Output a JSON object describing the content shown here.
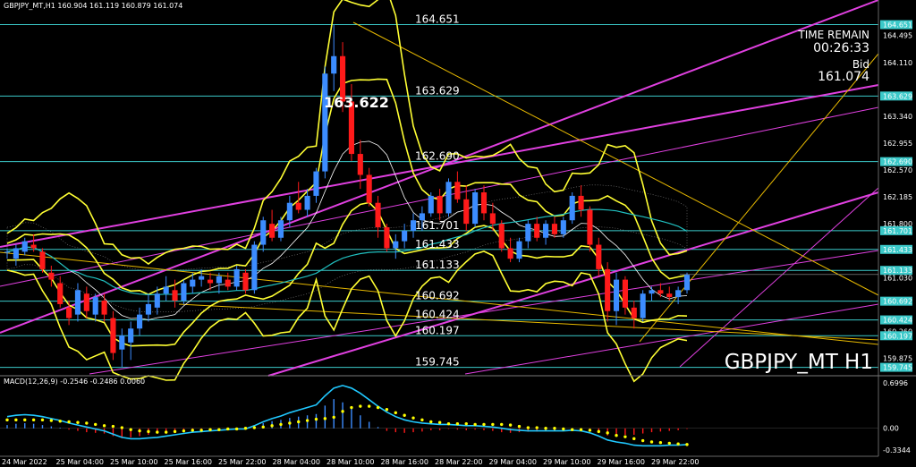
{
  "header": {
    "symbol_info": "GBPJPY_MT,H1  160.904 161.119 160.879 161.074"
  },
  "overlay": {
    "time_remain_label": "TIME REMAIN",
    "time_remain_value": "00:26:33",
    "bid_label": "Bid",
    "bid_value": "161.074",
    "watermark": "GBPJPY_MT H1",
    "peak_label": "163.622"
  },
  "macd": {
    "label": "MACD(12,26,9) -0.2546 -0.2486 0.0060",
    "y_ticks": [
      "0.6996",
      "0.00",
      "-0.3344"
    ]
  },
  "colors": {
    "background": "#000000",
    "bull_candle": "#3c8cff",
    "bear_candle": "#ff1a1a",
    "level_line": "#3bc9c9",
    "bollinger": "#ffff33",
    "channel": "#e040e0",
    "trendline": "#e6b800",
    "ma_cyan": "#20c0c0",
    "macd_line": "#20c8ff",
    "macd_signal": "#ffff00"
  },
  "chart_data": {
    "type": "candlestick",
    "symbol": "GBPJPY_MT",
    "timeframe": "H1",
    "ylim": [
      159.65,
      164.85
    ],
    "price_axis_ticks": [
      "164.651",
      "164.495",
      "164.110",
      "163.629",
      "163.340",
      "162.955",
      "162.690",
      "162.570",
      "162.185",
      "161.800",
      "161.701",
      "161.433",
      "161.133",
      "161.030",
      "160.692",
      "160.424",
      "160.260",
      "160.197",
      "159.875",
      "159.745"
    ],
    "time_axis_ticks": [
      "24 Mar 2022",
      "25 Mar 04:00",
      "25 Mar 10:00",
      "25 Mar 16:00",
      "25 Mar 22:00",
      "28 Mar 04:00",
      "28 Mar 10:00",
      "28 Mar 16:00",
      "28 Mar 22:00",
      "29 Mar 04:00",
      "29 Mar 10:00",
      "29 Mar 16:00",
      "29 Mar 22:00"
    ],
    "levels": [
      164.651,
      163.629,
      162.69,
      161.701,
      161.433,
      161.133,
      160.692,
      160.424,
      160.197,
      159.745
    ],
    "level_labels": [
      "164.651",
      "163.629",
      "162.690",
      "161.701",
      "161.433",
      "161.133",
      "160.692",
      "160.424",
      "160.197",
      "159.745"
    ],
    "candles": [
      [
        161.4,
        161.45,
        161.3,
        161.4
      ],
      [
        161.3,
        161.5,
        161.2,
        161.45
      ],
      [
        161.4,
        161.6,
        161.35,
        161.55
      ],
      [
        161.5,
        161.65,
        161.4,
        161.45
      ],
      [
        161.4,
        161.45,
        161.1,
        161.15
      ],
      [
        161.1,
        161.2,
        160.9,
        161.0
      ],
      [
        160.95,
        161.05,
        160.6,
        160.65
      ],
      [
        160.6,
        160.7,
        160.35,
        160.45
      ],
      [
        160.5,
        160.95,
        160.4,
        160.85
      ],
      [
        160.8,
        160.9,
        160.45,
        160.55
      ],
      [
        160.5,
        160.8,
        160.4,
        160.75
      ],
      [
        160.7,
        160.8,
        160.4,
        160.5
      ],
      [
        160.45,
        160.55,
        159.85,
        159.95
      ],
      [
        160.0,
        160.3,
        159.75,
        160.2
      ],
      [
        160.1,
        160.4,
        159.85,
        160.3
      ],
      [
        160.3,
        160.6,
        160.2,
        160.5
      ],
      [
        160.5,
        160.8,
        160.4,
        160.65
      ],
      [
        160.6,
        160.9,
        160.5,
        160.8
      ],
      [
        160.8,
        161.05,
        160.7,
        160.9
      ],
      [
        160.85,
        161.0,
        160.6,
        160.7
      ],
      [
        160.7,
        161.0,
        160.65,
        160.95
      ],
      [
        160.9,
        161.1,
        160.8,
        161.0
      ],
      [
        161.0,
        161.15,
        160.9,
        161.05
      ],
      [
        161.0,
        161.1,
        160.85,
        160.95
      ],
      [
        160.95,
        161.1,
        160.8,
        161.05
      ],
      [
        161.0,
        161.1,
        160.85,
        160.9
      ],
      [
        160.9,
        161.2,
        160.85,
        161.15
      ],
      [
        161.1,
        161.15,
        160.8,
        160.85
      ],
      [
        160.85,
        161.55,
        160.8,
        161.5
      ],
      [
        161.5,
        161.9,
        161.4,
        161.85
      ],
      [
        161.8,
        162.0,
        161.55,
        161.6
      ],
      [
        161.6,
        161.9,
        161.55,
        161.85
      ],
      [
        161.85,
        162.2,
        161.75,
        162.1
      ],
      [
        162.1,
        162.4,
        161.95,
        162.0
      ],
      [
        162.0,
        162.3,
        161.9,
        162.2
      ],
      [
        162.2,
        162.6,
        162.1,
        162.55
      ],
      [
        162.55,
        164.05,
        162.45,
        163.95
      ],
      [
        163.95,
        164.65,
        163.7,
        164.2
      ],
      [
        164.2,
        164.4,
        163.4,
        163.55
      ],
      [
        163.55,
        163.8,
        162.7,
        162.8
      ],
      [
        162.8,
        163.0,
        162.3,
        162.5
      ],
      [
        162.5,
        162.6,
        162.05,
        162.1
      ],
      [
        162.1,
        162.2,
        161.6,
        161.75
      ],
      [
        161.75,
        161.8,
        161.4,
        161.45
      ],
      [
        161.45,
        161.65,
        161.3,
        161.55
      ],
      [
        161.55,
        161.8,
        161.45,
        161.7
      ],
      [
        161.7,
        161.95,
        161.6,
        161.85
      ],
      [
        161.85,
        162.05,
        161.7,
        161.95
      ],
      [
        161.95,
        162.25,
        161.9,
        162.2
      ],
      [
        162.2,
        162.3,
        161.85,
        161.95
      ],
      [
        161.95,
        162.45,
        161.9,
        162.4
      ],
      [
        162.4,
        162.55,
        162.1,
        162.15
      ],
      [
        162.15,
        162.35,
        161.7,
        161.8
      ],
      [
        161.8,
        162.3,
        161.75,
        162.25
      ],
      [
        162.25,
        162.35,
        161.85,
        161.95
      ],
      [
        161.95,
        162.1,
        161.7,
        161.8
      ],
      [
        161.8,
        161.85,
        161.4,
        161.45
      ],
      [
        161.45,
        161.6,
        161.25,
        161.3
      ],
      [
        161.3,
        161.6,
        161.25,
        161.55
      ],
      [
        161.55,
        161.85,
        161.45,
        161.8
      ],
      [
        161.8,
        161.9,
        161.55,
        161.6
      ],
      [
        161.6,
        161.85,
        161.5,
        161.8
      ],
      [
        161.8,
        161.9,
        161.6,
        161.65
      ],
      [
        161.65,
        161.9,
        161.6,
        161.85
      ],
      [
        161.85,
        162.25,
        161.8,
        162.2
      ],
      [
        162.2,
        162.35,
        161.9,
        162.0
      ],
      [
        162.0,
        162.05,
        161.4,
        161.5
      ],
      [
        161.5,
        161.6,
        161.05,
        161.15
      ],
      [
        161.15,
        161.25,
        160.4,
        160.55
      ],
      [
        160.55,
        161.1,
        160.35,
        161.0
      ],
      [
        161.0,
        161.05,
        160.5,
        160.6
      ],
      [
        160.6,
        160.7,
        160.3,
        160.45
      ],
      [
        160.45,
        160.85,
        160.4,
        160.8
      ],
      [
        160.8,
        160.9,
        160.7,
        160.85
      ],
      [
        160.85,
        160.95,
        160.75,
        160.8
      ],
      [
        160.8,
        160.9,
        160.7,
        160.75
      ],
      [
        160.75,
        160.9,
        160.65,
        160.85
      ],
      [
        160.85,
        161.1,
        160.8,
        161.07
      ]
    ],
    "macd_hist": [
      0.05,
      0.07,
      0.08,
      0.07,
      0.05,
      0.03,
      0.01,
      -0.02,
      -0.04,
      -0.06,
      -0.07,
      -0.08,
      -0.12,
      -0.15,
      -0.14,
      -0.12,
      -0.1,
      -0.08,
      -0.06,
      -0.05,
      -0.04,
      -0.03,
      -0.02,
      -0.02,
      -0.01,
      -0.01,
      0.0,
      -0.01,
      0.03,
      0.08,
      0.11,
      0.13,
      0.16,
      0.18,
      0.2,
      0.22,
      0.35,
      0.45,
      0.4,
      0.3,
      0.2,
      0.1,
      0.02,
      -0.04,
      -0.06,
      -0.07,
      -0.06,
      -0.05,
      -0.03,
      -0.03,
      -0.01,
      -0.02,
      -0.03,
      -0.02,
      -0.03,
      -0.04,
      -0.06,
      -0.07,
      -0.06,
      -0.05,
      -0.05,
      -0.04,
      -0.04,
      -0.03,
      -0.01,
      -0.02,
      -0.04,
      -0.07,
      -0.11,
      -0.1,
      -0.1,
      -0.1,
      -0.08,
      -0.06,
      -0.05,
      -0.04,
      -0.03,
      -0.01
    ],
    "macd_line": [
      0.18,
      0.2,
      0.21,
      0.2,
      0.18,
      0.15,
      0.12,
      0.08,
      0.05,
      0.02,
      -0.01,
      -0.04,
      -0.09,
      -0.14,
      -0.16,
      -0.16,
      -0.15,
      -0.14,
      -0.12,
      -0.1,
      -0.08,
      -0.06,
      -0.05,
      -0.04,
      -0.03,
      -0.02,
      -0.01,
      -0.01,
      0.04,
      0.1,
      0.15,
      0.19,
      0.24,
      0.28,
      0.32,
      0.36,
      0.5,
      0.62,
      0.66,
      0.62,
      0.54,
      0.44,
      0.34,
      0.25,
      0.18,
      0.13,
      0.1,
      0.08,
      0.07,
      0.06,
      0.06,
      0.05,
      0.04,
      0.04,
      0.03,
      0.02,
      0.0,
      -0.02,
      -0.03,
      -0.04,
      -0.04,
      -0.04,
      -0.04,
      -0.04,
      -0.03,
      -0.04,
      -0.07,
      -0.12,
      -0.18,
      -0.21,
      -0.23,
      -0.26,
      -0.27,
      -0.27,
      -0.27,
      -0.26,
      -0.26,
      -0.25
    ],
    "macd_signal": [
      0.13,
      0.13,
      0.13,
      0.13,
      0.13,
      0.12,
      0.11,
      0.1,
      0.09,
      0.08,
      0.06,
      0.04,
      0.03,
      0.01,
      -0.02,
      -0.04,
      -0.05,
      -0.06,
      -0.06,
      -0.05,
      -0.04,
      -0.03,
      -0.03,
      -0.02,
      -0.02,
      -0.01,
      -0.01,
      0.0,
      0.01,
      0.02,
      0.04,
      0.06,
      0.08,
      0.1,
      0.12,
      0.14,
      0.15,
      0.17,
      0.26,
      0.32,
      0.34,
      0.34,
      0.32,
      0.29,
      0.24,
      0.2,
      0.16,
      0.13,
      0.1,
      0.09,
      0.07,
      0.07,
      0.07,
      0.06,
      0.06,
      0.06,
      0.06,
      0.05,
      0.03,
      0.01,
      0.01,
      0.0,
      0.0,
      -0.01,
      -0.02,
      -0.02,
      -0.03,
      -0.05,
      -0.07,
      -0.11,
      -0.13,
      -0.16,
      -0.19,
      -0.21,
      -0.22,
      -0.23,
      -0.24,
      -0.25
    ]
  }
}
